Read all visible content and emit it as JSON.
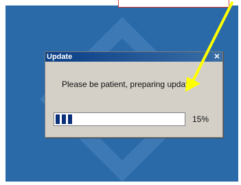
{
  "dialog": {
    "title": "Update",
    "close_glyph": "✕",
    "message": "Please be patient, preparing update!",
    "progress": {
      "percent_text": "15%",
      "value": 0.15
    }
  },
  "colors": {
    "desktop": "#2b6aa8",
    "titlebar_start": "#0a3e86",
    "titlebar_end": "#3a6ea5",
    "dialog_face": "#d4d0c8",
    "progress_fill": "#0a2f7a",
    "annotation_arrow": "#ffff00",
    "annotation_box": "#d63a3a"
  },
  "icons": [
    "close-icon"
  ]
}
